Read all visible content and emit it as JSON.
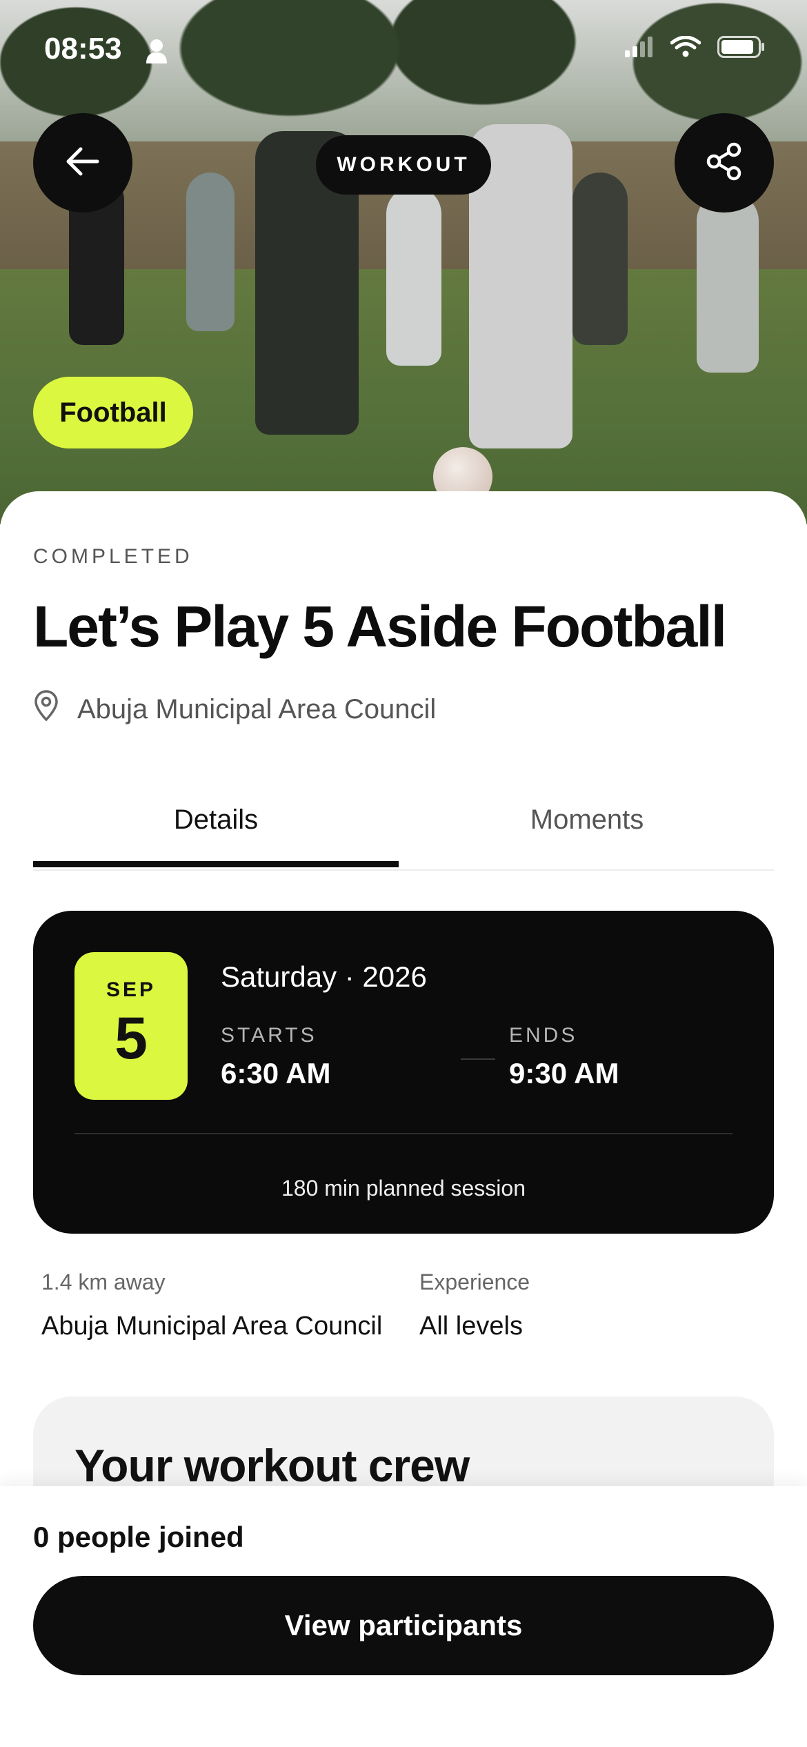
{
  "status_bar": {
    "time": "08:53"
  },
  "hero": {
    "category_label": "WORKOUT",
    "sport_badge": "Football"
  },
  "event": {
    "status": "COMPLETED",
    "title": "Let’s Play 5 Aside Football",
    "location": "Abuja Municipal Area Council"
  },
  "tabs": [
    {
      "label": "Details",
      "active": true
    },
    {
      "label": "Moments",
      "active": false
    }
  ],
  "schedule": {
    "month": "SEP",
    "day": "5",
    "day_line": "Saturday · 2026",
    "starts_label": "STARTS",
    "starts_time": "6:30 AM",
    "ends_label": "ENDS",
    "ends_time": "9:30 AM",
    "session_note": "180 min planned session"
  },
  "meta": {
    "distance_label": "1.4 km away",
    "distance_value": "Abuja Municipal Area Council",
    "experience_label": "Experience",
    "experience_value": "All levels"
  },
  "crew": {
    "title": "Your workout crew"
  },
  "footer": {
    "joined_text": "0 people joined",
    "cta_label": "View participants"
  },
  "colors": {
    "accent": "#dcf73f",
    "dark": "#0b0b0b"
  },
  "icons": {
    "back": "arrow-left-icon",
    "share": "share-icon",
    "location": "location-pin-icon"
  }
}
